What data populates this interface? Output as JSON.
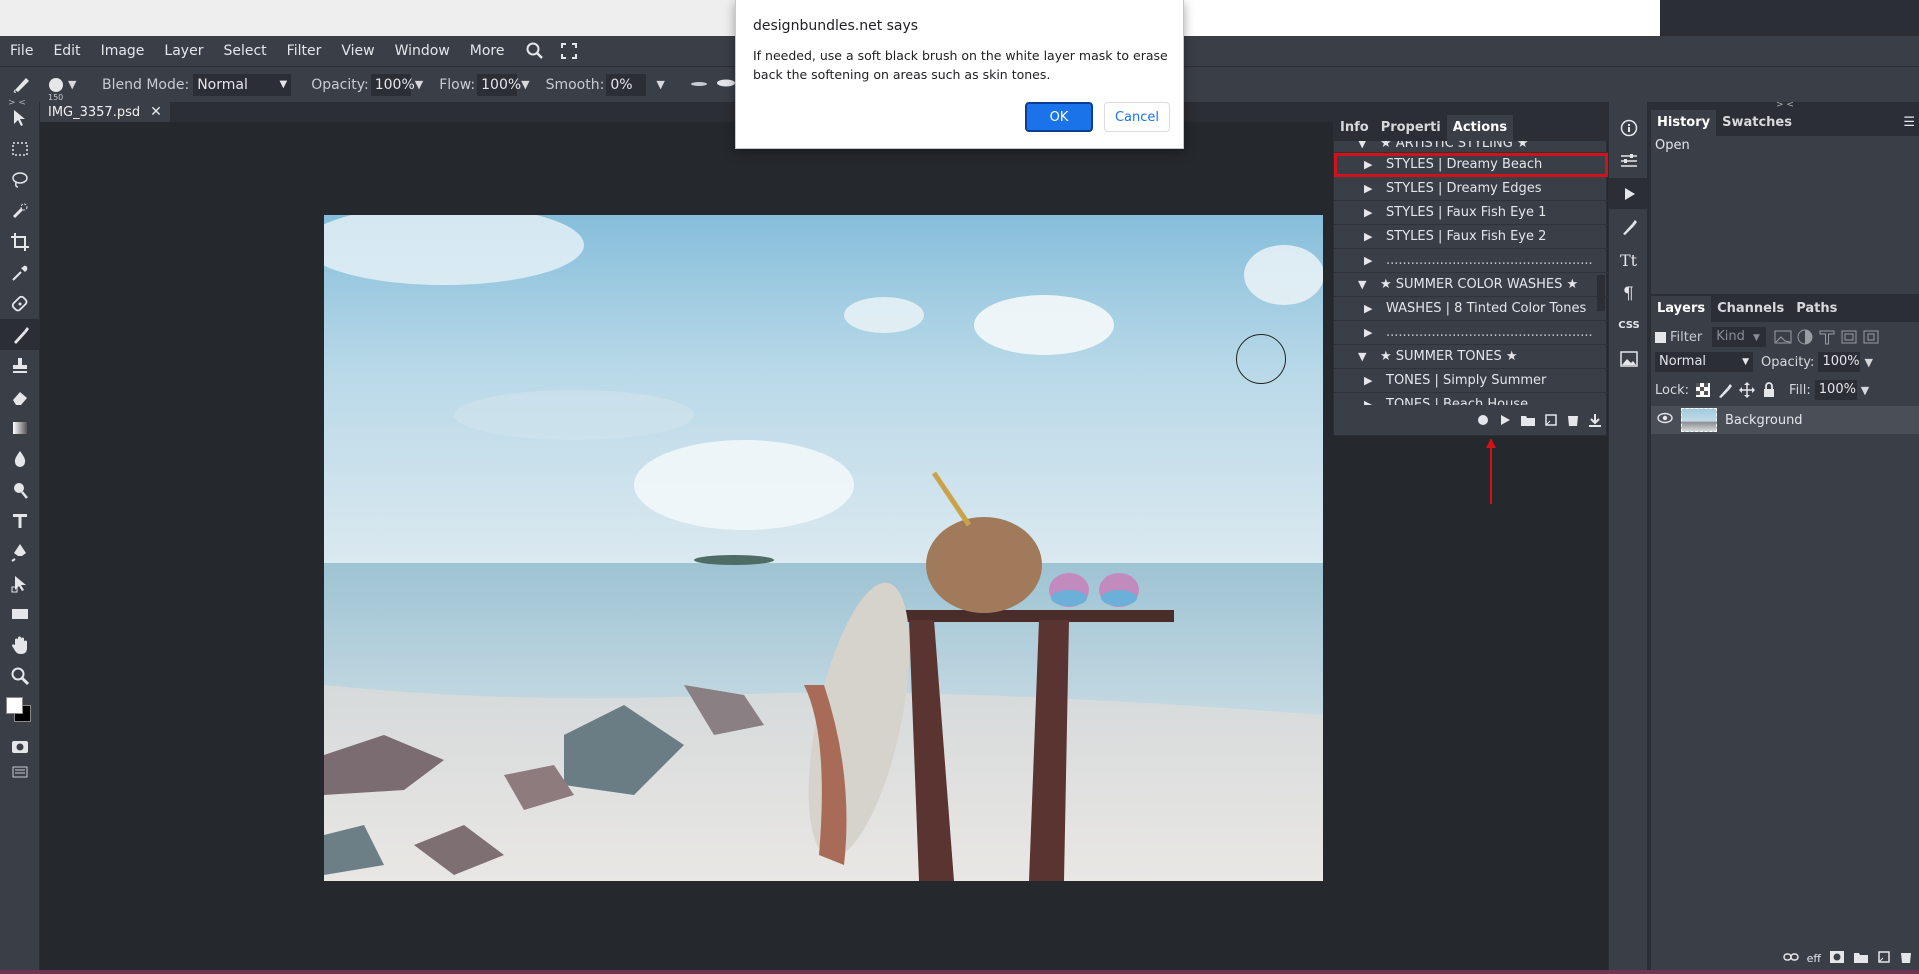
{
  "dialog": {
    "title": "designbundles.net says",
    "message": "If needed, use a soft black brush on the white layer mask to erase back the softening on areas such as skin tones.",
    "ok_label": "OK",
    "cancel_label": "Cancel"
  },
  "menubar": {
    "items": [
      "File",
      "Edit",
      "Image",
      "Layer",
      "Select",
      "Filter",
      "View",
      "Window",
      "More"
    ]
  },
  "options": {
    "brush_size": "150",
    "blend_label": "Blend Mode:",
    "blend_value": "Normal",
    "opacity_label": "Opacity:",
    "opacity_value": "100%",
    "flow_label": "Flow:",
    "flow_value": "100%",
    "smooth_label": "Smooth:",
    "smooth_value": "0%"
  },
  "document": {
    "tab_name": "IMG_3357.psd",
    "close_glyph": "✕"
  },
  "actions_panel": {
    "tabs": [
      "Info",
      "Properti",
      "Actions"
    ],
    "active_tab": "Actions",
    "rows": [
      {
        "label": "★ ARTISTIC STYLING ★",
        "kind": "set",
        "expanded": true
      },
      {
        "label": "STYLES | Dreamy Beach",
        "kind": "action",
        "highlight": true
      },
      {
        "label": "STYLES | Dreamy Edges",
        "kind": "action"
      },
      {
        "label": "STYLES | Faux Fish Eye 1",
        "kind": "action"
      },
      {
        "label": "STYLES | Faux Fish Eye 2",
        "kind": "action"
      },
      {
        "label": "...........................................................",
        "kind": "action"
      },
      {
        "label": "★ SUMMER COLOR WASHES ★",
        "kind": "set",
        "expanded": true
      },
      {
        "label": "WASHES | 8 Tinted Color Tones",
        "kind": "action"
      },
      {
        "label": "...........................................................",
        "kind": "action"
      },
      {
        "label": "★ SUMMER TONES ★",
        "kind": "set",
        "expanded": true
      },
      {
        "label": "TONES | Simply Summer",
        "kind": "action"
      },
      {
        "label": "TONES | Beach House",
        "kind": "action"
      }
    ],
    "footer_icons": [
      "record-icon",
      "play-icon",
      "folder-icon",
      "new-action-icon",
      "trash-icon",
      "download-icon"
    ]
  },
  "history_panel": {
    "tabs": [
      "History",
      "Swatches"
    ],
    "items": [
      "Open"
    ]
  },
  "layers_panel": {
    "tabs": [
      "Layers",
      "Channels",
      "Paths"
    ],
    "filter_label": "Filter",
    "kind_label": "Kind",
    "blend_value": "Normal",
    "opacity_label": "Opacity:",
    "opacity_value": "100%",
    "lock_label": "Lock:",
    "fill_label": "Fill:",
    "fill_value": "100%",
    "layers": [
      {
        "name": "Background",
        "visible": true
      }
    ],
    "footer_icons": [
      "link-icon",
      "eff",
      "mask-icon",
      "folder-icon",
      "new-layer-icon",
      "trash-icon"
    ],
    "footer_eff": "eff"
  },
  "right_strip": {
    "css_label": "CSS",
    "collapse_glyph": "> <"
  },
  "collapse": {
    "left": "> <",
    "mid": "< >"
  },
  "colors": {
    "accent": "#1a73e8",
    "highlight_outline": "#d0121b",
    "panel_bg": "#3a3e46",
    "app_bg": "#2b2e34"
  }
}
